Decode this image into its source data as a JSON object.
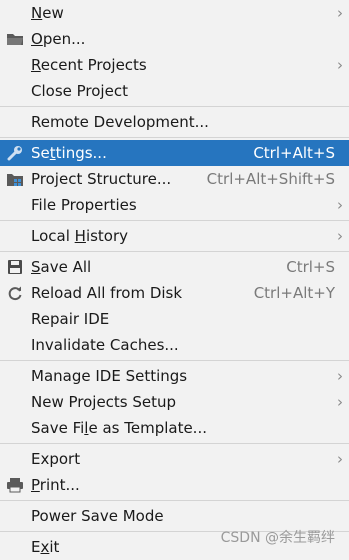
{
  "menu": {
    "new": {
      "label": "New",
      "underline": "N"
    },
    "open": {
      "label": "Open...",
      "underline": "O"
    },
    "recent": {
      "label": "Recent Projects",
      "underline": "R"
    },
    "close": {
      "label": "Close Project"
    },
    "remote": {
      "label": "Remote Development..."
    },
    "settings": {
      "label": "Settings...",
      "underline": "t",
      "shortcut": "Ctrl+Alt+S"
    },
    "structure": {
      "label": "Project Structure...",
      "shortcut": "Ctrl+Alt+Shift+S"
    },
    "file_props": {
      "label": "File Properties"
    },
    "local_history": {
      "label": "Local History",
      "underline": "H"
    },
    "save_all": {
      "label": "Save All",
      "underline": "S",
      "shortcut": "Ctrl+S"
    },
    "reload": {
      "label": "Reload All from Disk",
      "shortcut": "Ctrl+Alt+Y"
    },
    "repair": {
      "label": "Repair IDE"
    },
    "invalidate": {
      "label": "Invalidate Caches..."
    },
    "manage_ide": {
      "label": "Manage IDE Settings"
    },
    "new_projects": {
      "label": "New Projects Setup"
    },
    "save_template": {
      "label": "Save File as Template...",
      "underline": "l"
    },
    "export": {
      "label": "Export"
    },
    "print": {
      "label": "Print...",
      "underline": "P"
    },
    "power_save": {
      "label": "Power Save Mode"
    },
    "exit": {
      "label": "Exit",
      "underline": "x"
    }
  },
  "submenu_arrow": "›",
  "watermark": "CSDN @余生羁绊",
  "colors": {
    "selected": "#2675bf",
    "background": "#f2f2f2",
    "separator": "#d4d4d4"
  }
}
